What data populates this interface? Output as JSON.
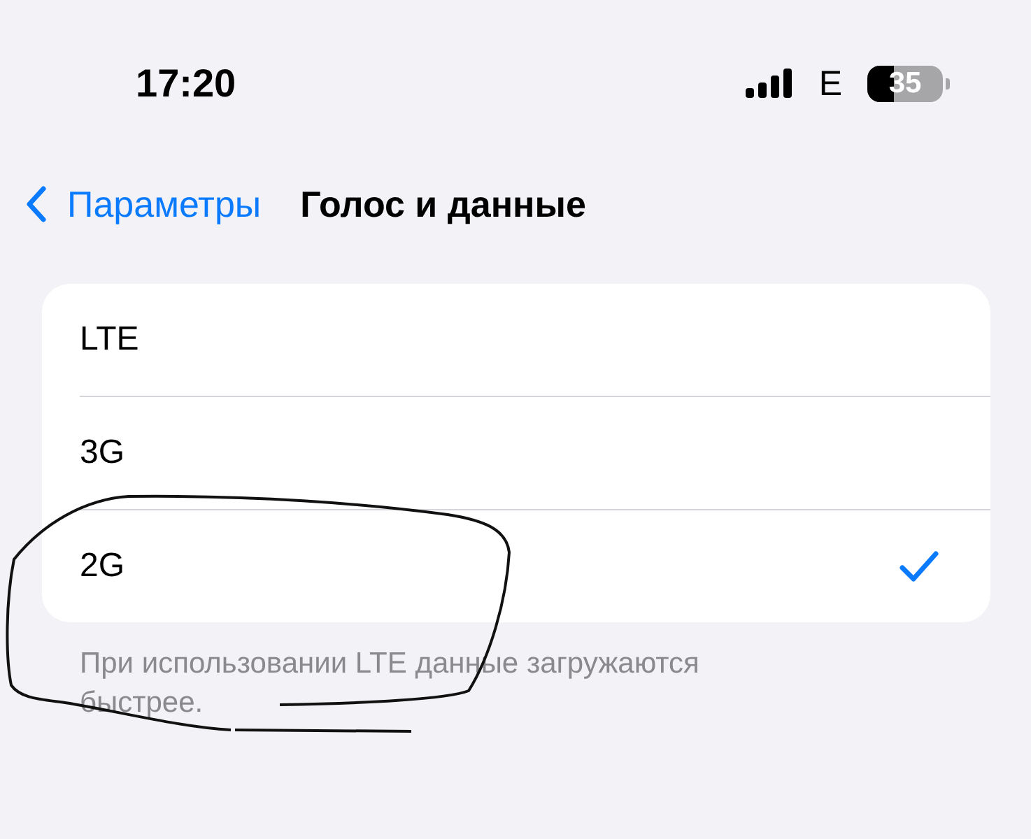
{
  "status_bar": {
    "time": "17:20",
    "network": "E",
    "battery": "35"
  },
  "nav": {
    "back": "Параметры",
    "title": "Голос и данные"
  },
  "options": [
    {
      "label": "LTE",
      "selected": false
    },
    {
      "label": "3G",
      "selected": false
    },
    {
      "label": "2G",
      "selected": true
    }
  ],
  "footer": "При использовании LTE данные загружаются быстрее."
}
